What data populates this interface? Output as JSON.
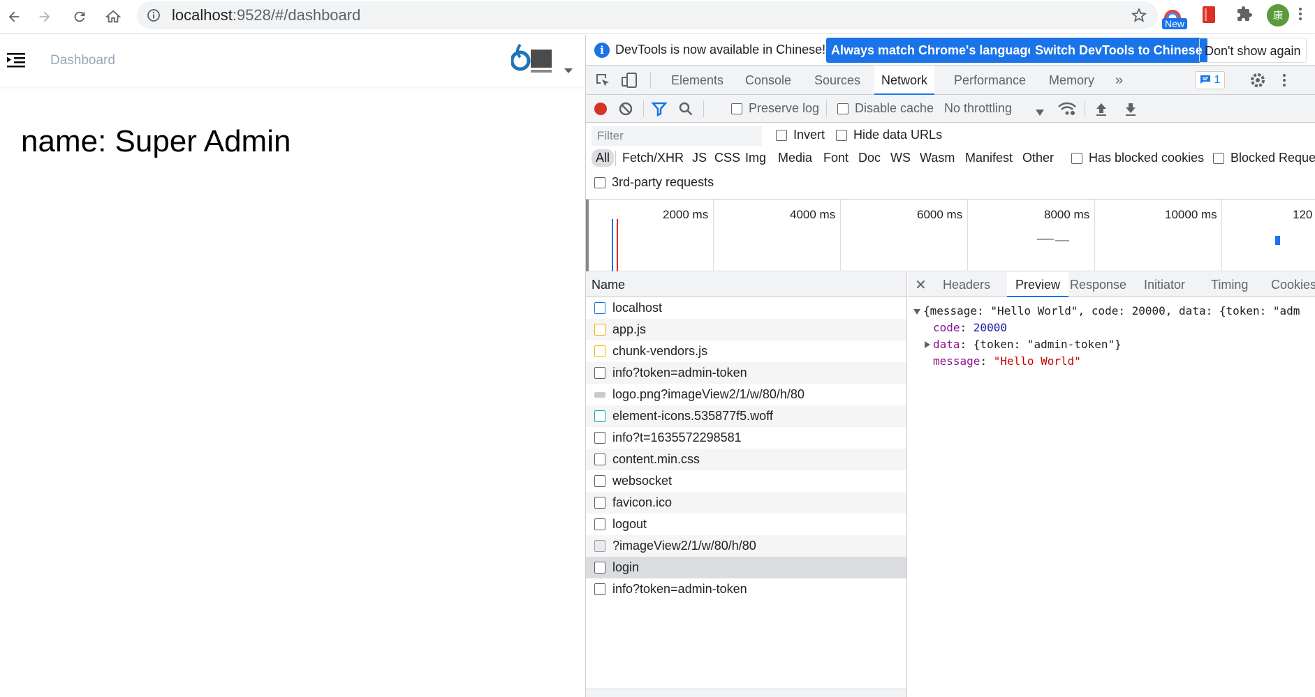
{
  "browser": {
    "url_host": "localhost",
    "url_rest": ":9528/#/dashboard",
    "new_badge": "New",
    "avatar_initial": "康"
  },
  "app": {
    "breadcrumb": "Dashboard",
    "name_line": "name: Super Admin"
  },
  "devtools": {
    "infobar": {
      "message": "DevTools is now available in Chinese!",
      "match_button": "Always match Chrome's language",
      "switch_button": "Switch DevTools to Chinese",
      "dismiss_button": "Don't show again"
    },
    "tabs": [
      "Elements",
      "Console",
      "Sources",
      "Network",
      "Performance",
      "Memory"
    ],
    "message_count": "1",
    "toolbar": {
      "preserve_log": "Preserve log",
      "disable_cache": "Disable cache",
      "throttling": "No throttling"
    },
    "filter": {
      "placeholder": "Filter",
      "invert": "Invert",
      "hide_data_urls": "Hide data URLs",
      "types": [
        "All",
        "Fetch/XHR",
        "JS",
        "CSS",
        "Img",
        "Media",
        "Font",
        "Doc",
        "WS",
        "Wasm",
        "Manifest",
        "Other"
      ],
      "has_blocked_cookies": "Has blocked cookies",
      "blocked_requests": "Blocked Reque",
      "third_party": "3rd-party requests"
    },
    "timeline_labels": [
      "2000 ms",
      "4000 ms",
      "6000 ms",
      "8000 ms",
      "10000 ms",
      "120"
    ],
    "name_header": "Name",
    "requests": [
      "localhost",
      "app.js",
      "chunk-vendors.js",
      "info?token=admin-token",
      "logo.png?imageView2/1/w/80/h/80",
      "element-icons.535877f5.woff",
      "info?t=1635572298581",
      "content.min.css",
      "websocket",
      "favicon.ico",
      "logout",
      "?imageView2/1/w/80/h/80",
      "login",
      "info?token=admin-token"
    ],
    "detail_tabs": [
      "Headers",
      "Preview",
      "Response",
      "Initiator",
      "Timing",
      "Cookies"
    ],
    "preview": {
      "summary": "{message: \"Hello World\", code: 20000, data: {token: \"adm",
      "code_key": "code",
      "code_value": "20000",
      "data_key": "data",
      "data_value": "{token: \"admin-token\"}",
      "message_key": "message",
      "message_value": "\"Hello World\""
    }
  }
}
